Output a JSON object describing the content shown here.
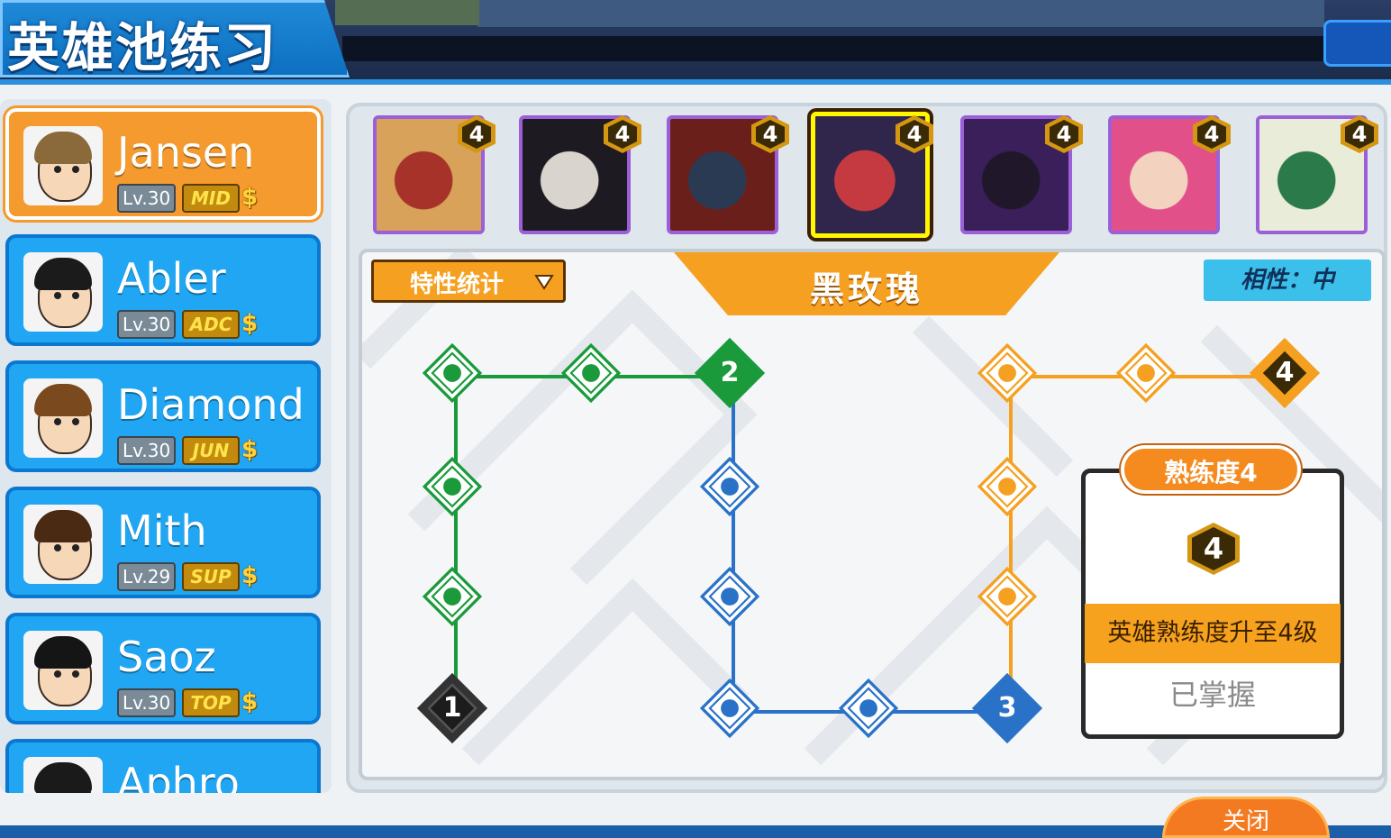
{
  "header": {
    "title": "英雄池练习"
  },
  "players": [
    {
      "name": "Jansen",
      "level": "Lv.30",
      "position": "MID",
      "selected": true,
      "hair": "#8a6a3a"
    },
    {
      "name": "Abler",
      "level": "Lv.30",
      "position": "ADC",
      "selected": false,
      "hair": "#1b1b1b"
    },
    {
      "name": "Diamond",
      "level": "Lv.30",
      "position": "JUN",
      "selected": false,
      "hair": "#7a4a1e"
    },
    {
      "name": "Mith",
      "level": "Lv.29",
      "position": "SUP",
      "selected": false,
      "hair": "#4a2a12"
    },
    {
      "name": "Saoz",
      "level": "Lv.30",
      "position": "TOP",
      "selected": false,
      "hair": "#151515"
    },
    {
      "name": "Aphro",
      "level": "",
      "position": "",
      "selected": false,
      "hair": "#1a1a1a"
    }
  ],
  "heroes": [
    {
      "art": "monkey-warrior",
      "mastery": "4",
      "colors": [
        "#d8a25a",
        "#a6322a"
      ]
    },
    {
      "art": "vampire",
      "mastery": "4",
      "colors": [
        "#1e1a22",
        "#d9d4cd"
      ]
    },
    {
      "art": "demon",
      "mastery": "4",
      "colors": [
        "#6b1f1a",
        "#2a3a52"
      ]
    },
    {
      "art": "black-rose",
      "mastery": "4",
      "colors": [
        "#30254a",
        "#c43a40"
      ],
      "selected": true
    },
    {
      "art": "shadow-mage",
      "mastery": "4",
      "colors": [
        "#3a1f5a",
        "#20182a"
      ]
    },
    {
      "art": "pink-hair-girl",
      "mastery": "4",
      "colors": [
        "#e2508a",
        "#f3d2c0"
      ]
    },
    {
      "art": "masked-ninja",
      "mastery": "4",
      "colors": [
        "#e9ecd8",
        "#2a7a4a"
      ]
    }
  ],
  "board": {
    "stats_dropdown": "特性统计",
    "hero_name": "黑玫瑰",
    "affinity": "相性：中",
    "colors": {
      "green": "#1a9a3a",
      "blue": "#2a72c8",
      "orange": "#f5a020"
    },
    "milestones": {
      "one": "1",
      "two": "2",
      "three": "3",
      "four": "4"
    }
  },
  "mastery_popup": {
    "title": "熟练度4",
    "level": "4",
    "description": "英雄熟练度升至4级",
    "status": "已掌握"
  },
  "footer": {
    "confirm": "关闭"
  }
}
